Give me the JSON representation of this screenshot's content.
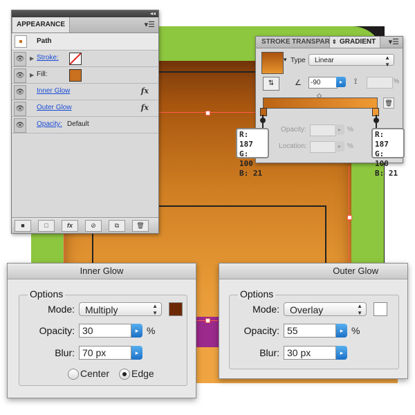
{
  "appearance": {
    "tab": "APPEARANCE",
    "object": "Path",
    "stroke_label": "Stroke:",
    "fill_label": "Fill:",
    "inner_glow": "Inner Glow",
    "outer_glow": "Outer Glow",
    "opacity_label": "Opacity:",
    "opacity_value": "Default",
    "fx": "fx",
    "fill_color": "#c8701e"
  },
  "gradient": {
    "tabs": [
      "STROKE",
      "TRANSPARE",
      "GRADIENT"
    ],
    "type_label": "Type",
    "type_value": "Linear",
    "angle_value": "-90",
    "percent": "%",
    "opacity_label": "Opacity:",
    "location_label": "Location:",
    "start_color": "#bb6415",
    "end_color": "#f09a35",
    "left_stop": [
      "R: 187",
      "G: 100",
      "B: 21"
    ],
    "right_stop": [
      "R: 187",
      "G: 100",
      "B: 21"
    ]
  },
  "inner_glow_dialog": {
    "title": "Inner Glow",
    "group": "Options",
    "mode_label": "Mode:",
    "mode_value": "Multiply",
    "color": "#6b2a05",
    "opacity_label": "Opacity:",
    "opacity_value": "30",
    "percent": "%",
    "blur_label": "Blur:",
    "blur_value": "70 px",
    "center_label": "Center",
    "edge_label": "Edge",
    "selected": "Edge"
  },
  "outer_glow_dialog": {
    "title": "Outer Glow",
    "group": "Options",
    "mode_label": "Mode:",
    "mode_value": "Overlay",
    "color": "#ffffff",
    "opacity_label": "Opacity:",
    "opacity_value": "55",
    "percent": "%",
    "blur_label": "Blur:",
    "blur_value": "30 px"
  }
}
